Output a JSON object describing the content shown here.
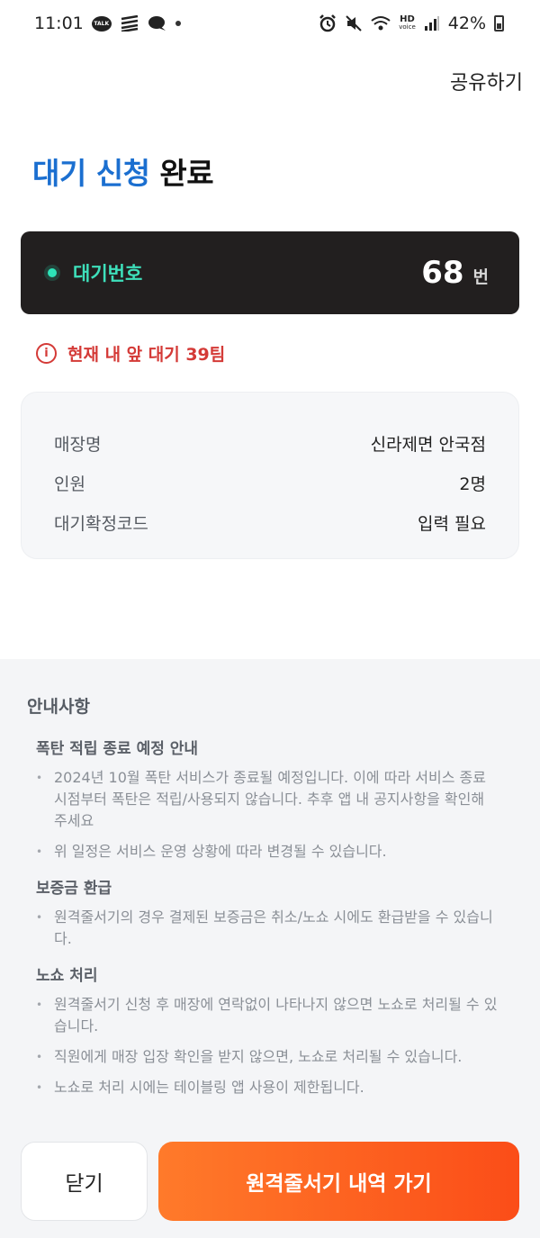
{
  "status_bar": {
    "time": "11:01",
    "talk_icon_text": "TALK",
    "hd_text": "HD",
    "voice_text": "voice",
    "battery": "42%"
  },
  "header": {
    "share_label": "공유하기",
    "title_accent": "대기 신청",
    "title_rest": " 완료"
  },
  "queue": {
    "label": "대기번호",
    "number": "68",
    "unit": "번"
  },
  "alert": {
    "icon_glyph": "i",
    "text": "현재 내 앞 대기 39팀"
  },
  "info": {
    "rows": [
      {
        "label": "매장명",
        "value": "신라제면 안국점"
      },
      {
        "label": "인원",
        "value": "2명"
      },
      {
        "label": "대기확정코드",
        "value": "입력 필요"
      }
    ]
  },
  "notice": {
    "title": "안내사항",
    "sections": [
      {
        "heading": "폭탄 적립 종료 예정 안내",
        "items": [
          "2024년 10월 폭탄 서비스가 종료될 예정입니다. 이에 따라 서비스 종료 시점부터 폭탄은 적립/사용되지 않습니다. 추후 앱 내 공지사항을 확인해 주세요",
          "위 일정은 서비스 운영 상황에 따라 변경될 수 있습니다."
        ]
      },
      {
        "heading": "보증금 환급",
        "items": [
          "원격줄서기의 경우 결제된 보증금은 취소/노쇼 시에도 환급받을 수 있습니다."
        ]
      },
      {
        "heading": "노쇼 처리",
        "items": [
          "원격줄서기 신청 후 매장에 연락없이 나타나지 않으면 노쇼로 처리될 수 있습니다.",
          "직원에게 매장 입장 확인을 받지 않으면, 노쇼로 처리될 수 있습니다.",
          "노쇼로 처리 시에는 테이블링 앱 사용이 제한됩니다."
        ]
      }
    ]
  },
  "buttons": {
    "close_label": "닫기",
    "history_label": "원격줄서기 내역 가기"
  },
  "colors": {
    "accent_blue": "#1b6fd0",
    "teal": "#3ee0bb",
    "alert_red": "#d43a37",
    "cta_orange": "#fb4d18"
  }
}
